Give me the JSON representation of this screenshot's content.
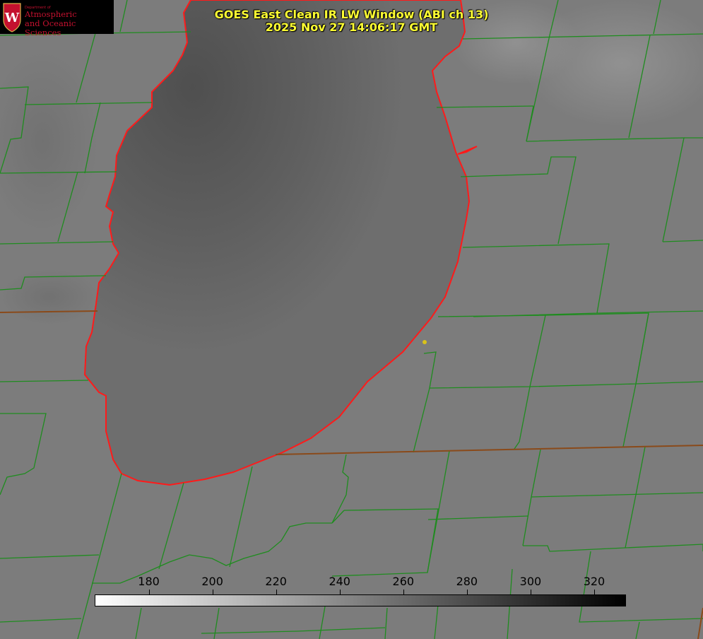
{
  "header": {
    "title_line1": "GOES East Clean IR LW Window (ABI ch 13)",
    "title_line2": "2025 Nov 27 14:06:17 GMT"
  },
  "logo": {
    "dept_text": "Department of",
    "line1": "Atmospheric",
    "line2": "and Oceanic Sciences",
    "icon": "uw-crest-icon"
  },
  "colorbar": {
    "min_value": 163,
    "max_value": 330,
    "gradient_start": "#ffffff",
    "gradient_end": "#000000",
    "ticks": [
      {
        "value": 180,
        "label": "180"
      },
      {
        "value": 200,
        "label": "200"
      },
      {
        "value": 220,
        "label": "220"
      },
      {
        "value": 240,
        "label": "240"
      },
      {
        "value": 260,
        "label": "260"
      },
      {
        "value": 280,
        "label": "280"
      },
      {
        "value": 300,
        "label": "300"
      },
      {
        "value": 320,
        "label": "320"
      }
    ]
  },
  "colors": {
    "title": "#ffff33",
    "county_lines": "#1f8c1f",
    "state_lines": "#8a4a1a",
    "lake_outline": "#ff1a1a",
    "station_marker": "#d9c21a",
    "land": "#7c7c7c",
    "lake_dark": "#545454"
  }
}
